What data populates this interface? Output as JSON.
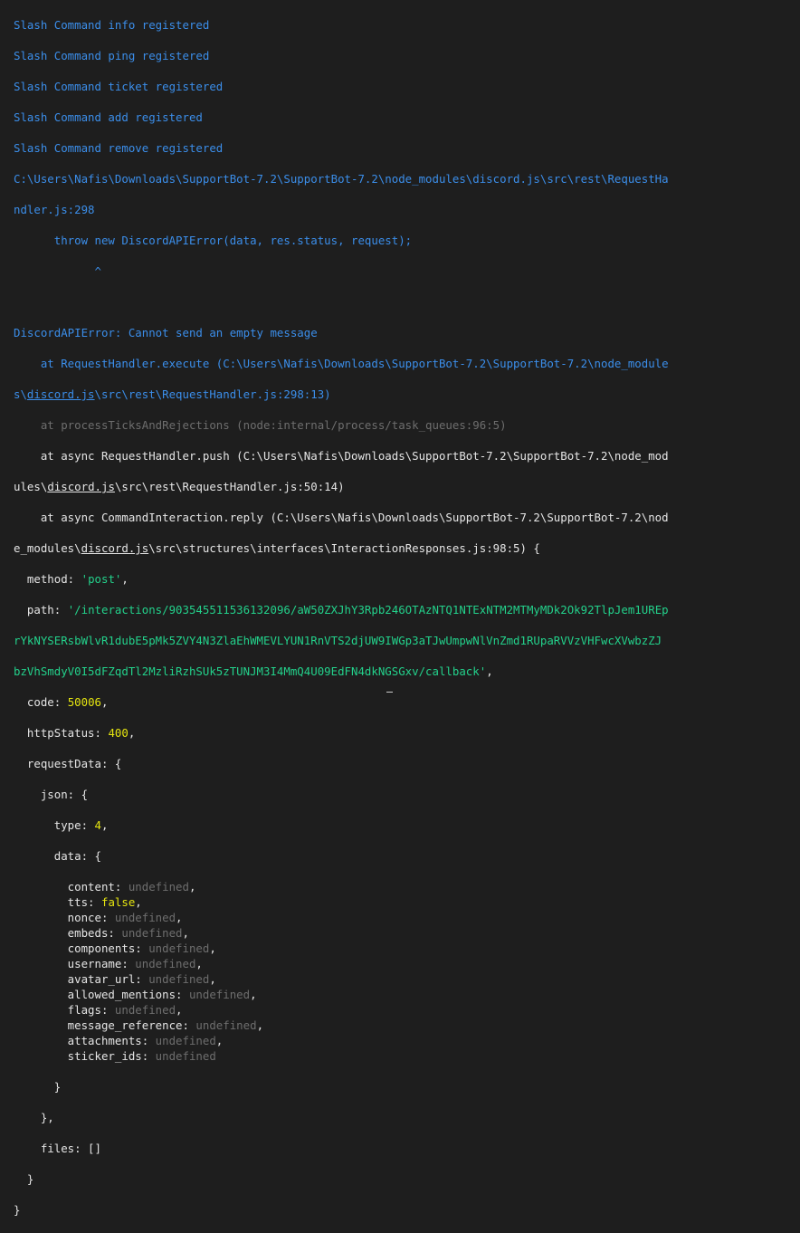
{
  "terminal": {
    "registered": [
      "Slash Command info registered",
      "Slash Command ping registered",
      "Slash Command ticket registered",
      "Slash Command add registered",
      "Slash Command remove registered"
    ],
    "path_line_1": "C:\\Users\\Nafis\\Downloads\\SupportBot-7.2\\SupportBot-7.2\\node_modules\\discord.js\\src\\rest\\RequestHa",
    "path_line_2": "ndler.js:298",
    "throw_line": "      throw new DiscordAPIError(data, res.status, request);",
    "caret_line": "            ^",
    "error_message": "DiscordAPIError: Cannot send an empty message",
    "stack": {
      "frame1_a": "    at RequestHandler.execute (C:\\Users\\Nafis\\Downloads\\SupportBot-7.2\\SupportBot-7.2\\node_module",
      "frame1_b_pre": "s\\",
      "frame1_b_link": "discord.js",
      "frame1_b_post": "\\src\\rest\\RequestHandler.js:298:13)",
      "frame2": "    at processTicksAndRejections (node:internal/process/task_queues:96:5)",
      "frame3_a": "    at async RequestHandler.push (C:\\Users\\Nafis\\Downloads\\SupportBot-7.2\\SupportBot-7.2\\node_mod",
      "frame3_b_pre": "ules\\",
      "frame3_b_link": "discord.js",
      "frame3_b_post": "\\src\\rest\\RequestHandler.js:50:14)",
      "frame4_a": "    at async CommandInteraction.reply (C:\\Users\\Nafis\\Downloads\\SupportBot-7.2\\SupportBot-7.2\\nod",
      "frame4_b_pre": "e_modules\\",
      "frame4_b_link": "discord.js",
      "frame4_b_post": "\\src\\structures\\interfaces\\InteractionResponses.js:98:5) {"
    },
    "method_key": "  method: ",
    "method_val": "'post'",
    "path_key": "  path: ",
    "path_val_1": "'/interactions/903545511536132096/aW50ZXJhY3Rpb246OTAzNTQ1NTExNTM2MTMyMDk2Ok92TlpJem1UREp",
    "path_val_2": "rYkNYSERsbWlvR1dubE5pMk5ZVY4N3ZlaEhWMEVLYUN1RnVTS2djUW9IWGp3aTJwUmpwNlVnZmd1RUpaRVVzVHFwcXVwbzZJ",
    "path_val_3": "bzVhSmdyV0I5dFZqdTl2MzliRzhSUk5zTUNJM3I4MmQ4U09EdFN4dkNGSGxv/callback'",
    "code_key": "  code: ",
    "code_val": "50006",
    "status_key": "  httpStatus: ",
    "status_val": "400",
    "request_data": "  requestData: {",
    "json_open": "    json: {",
    "type_key": "      type: ",
    "type_val": "4",
    "data_open": "      data: {",
    "fields": [
      {
        "key": "        content: ",
        "val": "undefined",
        "style": "gray",
        "end": ","
      },
      {
        "key": "        tts: ",
        "val": "false",
        "style": "yellow",
        "end": ","
      },
      {
        "key": "        nonce: ",
        "val": "undefined",
        "style": "gray",
        "end": ","
      },
      {
        "key": "        embeds: ",
        "val": "undefined",
        "style": "gray",
        "end": ","
      },
      {
        "key": "        components: ",
        "val": "undefined",
        "style": "gray",
        "end": ","
      },
      {
        "key": "        username: ",
        "val": "undefined",
        "style": "gray",
        "end": ","
      },
      {
        "key": "        avatar_url: ",
        "val": "undefined",
        "style": "gray",
        "end": ","
      },
      {
        "key": "        allowed_mentions: ",
        "val": "undefined",
        "style": "gray",
        "end": ","
      },
      {
        "key": "        flags: ",
        "val": "undefined",
        "style": "gray",
        "end": ","
      },
      {
        "key": "        message_reference: ",
        "val": "undefined",
        "style": "gray",
        "end": ","
      },
      {
        "key": "        attachments: ",
        "val": "undefined",
        "style": "gray",
        "end": ","
      },
      {
        "key": "        sticker_ids: ",
        "val": "undefined",
        "style": "gray",
        "end": ""
      }
    ],
    "close_data": "      }",
    "close_json": "    },",
    "files_line": "    files: []",
    "close_request": "  }",
    "close_all": "}"
  }
}
